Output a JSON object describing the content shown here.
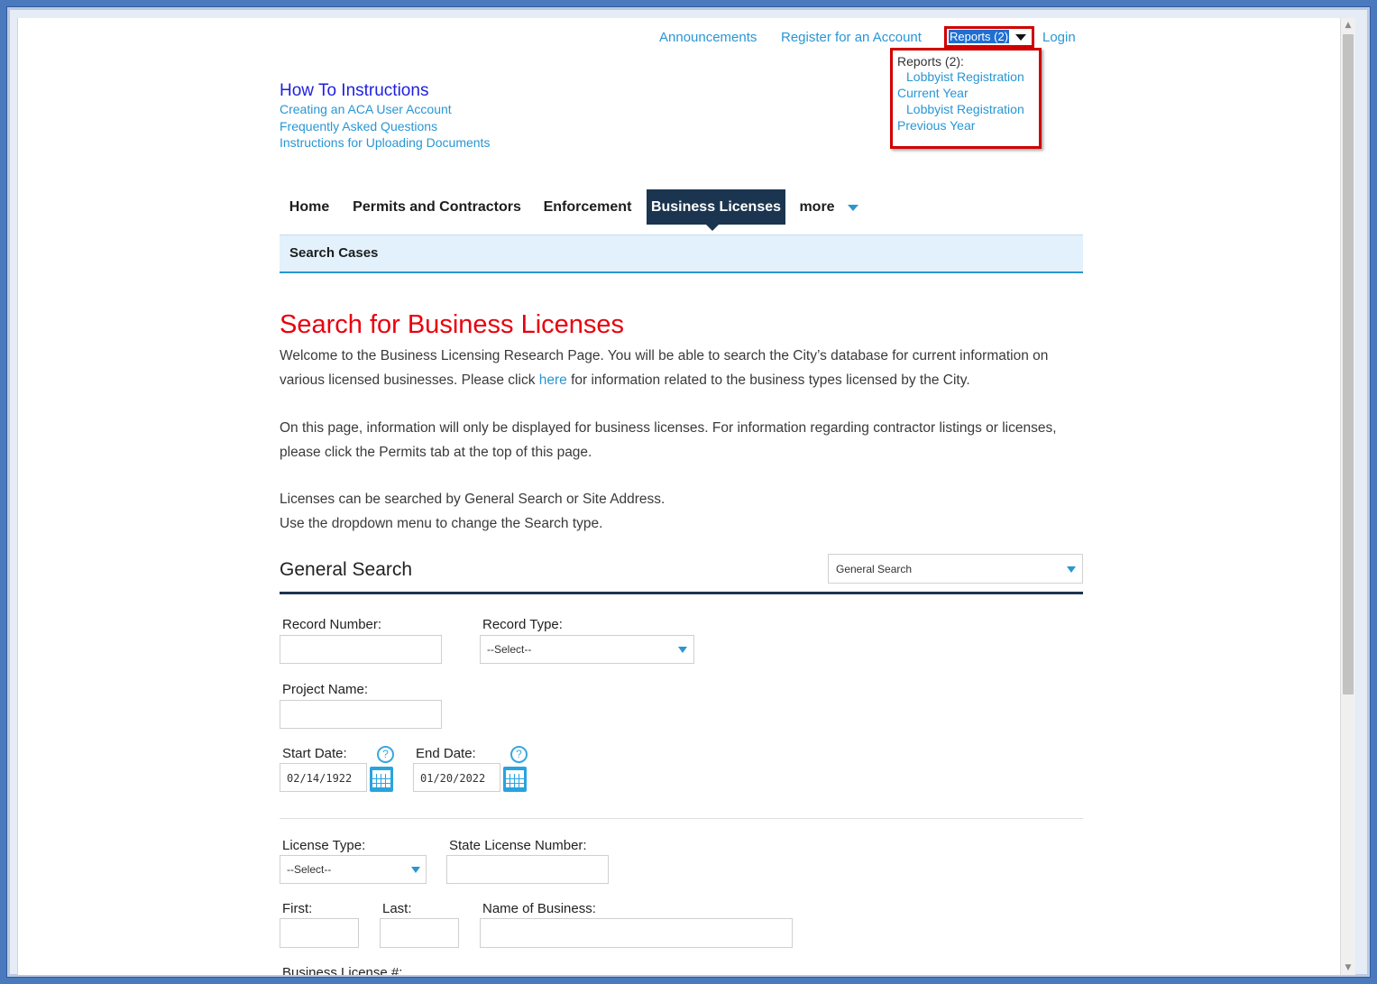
{
  "header": {
    "announcements": "Announcements",
    "register": "Register for an Account",
    "reports_toggle": "Reports (2)",
    "login": "Login"
  },
  "reports_panel": {
    "title": "Reports (2):",
    "items": [
      {
        "line1": "Lobbyist Registration",
        "line2": "Current Year"
      },
      {
        "line1": "Lobbyist Registration",
        "line2": "Previous Year"
      }
    ]
  },
  "howto": {
    "title": "How To Instructions",
    "links": [
      "Creating an ACA User Account",
      "Frequently Asked Questions",
      "Instructions for Uploading Documents"
    ]
  },
  "nav": {
    "tabs": [
      "Home",
      "Permits and Contractors",
      "Enforcement",
      "Business Licenses",
      "more"
    ],
    "active": "Business Licenses",
    "subnav": "Search Cases"
  },
  "page": {
    "title": "Search for Business Licenses",
    "p1_before": "Welcome to the Business Licensing Research Page.  You will be able to search the City’s database for current information on various licensed businesses.  Please click ",
    "p1_link": "here",
    "p1_after": " for information related to the business types licensed by the City.",
    "p2": "On this page, information will only be displayed for business licenses.  For information regarding contractor listings or licenses, please click the Permits tab at the top of this page.",
    "p3_line1": "Licenses can be searched by General Search or Site Address.",
    "p3_line2": "Use the dropdown menu to change the Search type."
  },
  "search": {
    "section_title": "General Search",
    "search_type_value": "General Search",
    "record_number_label": "Record Number:",
    "record_type_label": "Record Type:",
    "record_type_value": "--Select--",
    "project_name_label": "Project Name:",
    "start_date_label": "Start Date:",
    "start_date_value": "02/14/1922",
    "end_date_label": "End Date:",
    "end_date_value": "01/20/2022",
    "license_type_label": "License Type:",
    "license_type_value": "--Select--",
    "state_license_label": "State License Number:",
    "first_label": "First:",
    "last_label": "Last:",
    "business_name_label": "Name of Business:",
    "business_license_label": "Business License #:"
  },
  "icons": {
    "help": "?",
    "scroll_up": "▲",
    "scroll_down": "▼"
  },
  "colors": {
    "link": "#2996d3",
    "title_red": "#e8000d",
    "active_tab": "#1b3550",
    "highlight_border": "#d00000"
  }
}
